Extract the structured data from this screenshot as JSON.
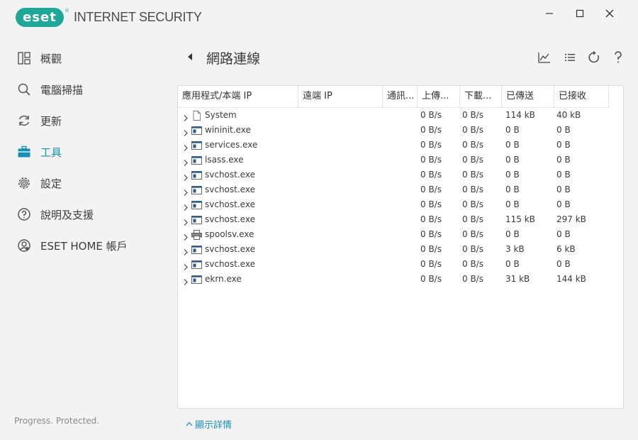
{
  "app": {
    "logo_text": "eset",
    "logo_reg": "®",
    "product_name": "INTERNET SECURITY",
    "accent_color": "#1fa79a",
    "link_color": "#1b8fb0"
  },
  "sidebar": {
    "items": [
      {
        "label": "概觀",
        "icon": "overview-icon"
      },
      {
        "label": "電腦掃描",
        "icon": "search-icon"
      },
      {
        "label": "更新",
        "icon": "refresh-icon"
      },
      {
        "label": "工具",
        "icon": "briefcase-icon",
        "active": true
      },
      {
        "label": "設定",
        "icon": "gear-icon"
      },
      {
        "label": "說明及支援",
        "icon": "help-icon"
      },
      {
        "label": "ESET HOME 帳戶",
        "icon": "account-icon"
      }
    ],
    "tagline": "Progress. Protected."
  },
  "page": {
    "title": "網路連線",
    "details_link": "顯示詳情"
  },
  "table": {
    "columns": [
      "應用程式/本端 IP",
      "遠端 IP",
      "通訊...",
      "上傳...",
      "下載...",
      "已傳送",
      "已接收"
    ],
    "rows": [
      {
        "name": "System",
        "icon": "file",
        "up": "0 B/s",
        "down": "0 B/s",
        "sent": "114 kB",
        "recv": "40 kB"
      },
      {
        "name": "wininit.exe",
        "icon": "window",
        "up": "0 B/s",
        "down": "0 B/s",
        "sent": "0 B",
        "recv": "0 B"
      },
      {
        "name": "services.exe",
        "icon": "window",
        "up": "0 B/s",
        "down": "0 B/s",
        "sent": "0 B",
        "recv": "0 B"
      },
      {
        "name": "lsass.exe",
        "icon": "window",
        "up": "0 B/s",
        "down": "0 B/s",
        "sent": "0 B",
        "recv": "0 B"
      },
      {
        "name": "svchost.exe",
        "icon": "window",
        "up": "0 B/s",
        "down": "0 B/s",
        "sent": "0 B",
        "recv": "0 B"
      },
      {
        "name": "svchost.exe",
        "icon": "window",
        "up": "0 B/s",
        "down": "0 B/s",
        "sent": "0 B",
        "recv": "0 B"
      },
      {
        "name": "svchost.exe",
        "icon": "window",
        "up": "0 B/s",
        "down": "0 B/s",
        "sent": "0 B",
        "recv": "0 B"
      },
      {
        "name": "svchost.exe",
        "icon": "window",
        "up": "0 B/s",
        "down": "0 B/s",
        "sent": "115 kB",
        "recv": "297 kB"
      },
      {
        "name": "spoolsv.exe",
        "icon": "printer",
        "up": "0 B/s",
        "down": "0 B/s",
        "sent": "0 B",
        "recv": "0 B"
      },
      {
        "name": "svchost.exe",
        "icon": "window",
        "up": "0 B/s",
        "down": "0 B/s",
        "sent": "3 kB",
        "recv": "6 kB"
      },
      {
        "name": "svchost.exe",
        "icon": "window",
        "up": "0 B/s",
        "down": "0 B/s",
        "sent": "0 B",
        "recv": "0 B"
      },
      {
        "name": "ekrn.exe",
        "icon": "window",
        "up": "0 B/s",
        "down": "0 B/s",
        "sent": "31 kB",
        "recv": "144 kB"
      }
    ]
  }
}
